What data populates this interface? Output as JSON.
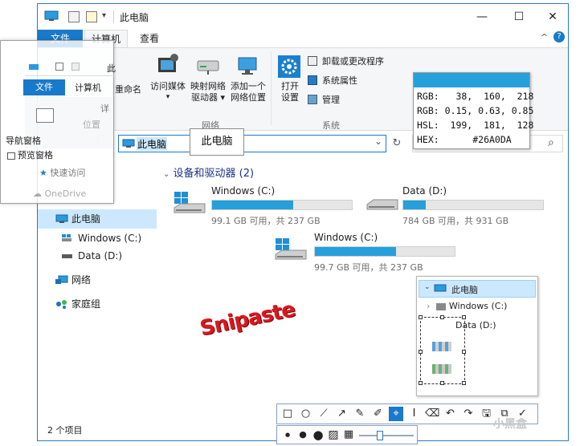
{
  "window": {
    "title": "此电脑",
    "tabs": [
      "文件",
      "计算机",
      "查看"
    ],
    "controls": {
      "minimize": "—",
      "maximize": "☐",
      "close": "✕"
    }
  },
  "ribbon": {
    "network_items": [
      {
        "label1": "访问媒体",
        "label2": "▾"
      },
      {
        "label1": "映射网络",
        "label2": "驱动器 ▾"
      },
      {
        "label1": "添加一个",
        "label2": "网络位置"
      }
    ],
    "network_group": "网络",
    "settings": {
      "label1": "打开",
      "label2": "设置"
    },
    "system_items": [
      "卸载或更改程序",
      "系统属性",
      "管理"
    ],
    "system_group": "系统",
    "partial_label": "重命名"
  },
  "address": {
    "value": "此电脑",
    "refresh": "↻",
    "dropdown": "⌄",
    "search_icon": "⌕"
  },
  "tooltip": "此电脑",
  "color_picker": {
    "swatch": "#26A0DA",
    "rows": [
      "RGB:   38,  160,  218",
      "RGB: 0.15, 0.63, 0.85",
      "HSL:  199,  181,  128",
      "HEX:      #26A0DA"
    ]
  },
  "nav": {
    "items": [
      {
        "label": "此电脑",
        "selected": true
      },
      {
        "label": "Windows (C:)"
      },
      {
        "label": "Data (D:)"
      },
      {
        "label": "网络"
      },
      {
        "label": "家庭组"
      }
    ]
  },
  "ghost_window": {
    "tabs": [
      "文件",
      "计算机"
    ],
    "items": [
      "导航窗格",
      "预览窗格",
      "快速访问",
      "OneDrive",
      "此",
      "详",
      "位置"
    ]
  },
  "content": {
    "section_title": "设备和驱动器 (2)",
    "drives": [
      {
        "name": "Windows (C:)",
        "space": "99.1 GB 可用，共 237 GB",
        "used_fraction": 0.58
      },
      {
        "name": "Data (D:)",
        "space": "784 GB 可用，共 931 GB",
        "used_fraction": 0.16
      },
      {
        "name": "Windows (C:)",
        "space": "99.7 GB 可用，共 237 GB",
        "used_fraction": 0.58
      }
    ]
  },
  "mini_tree": {
    "items": [
      "此电脑",
      "Windows (C:)",
      "Data (D:)"
    ]
  },
  "status": {
    "count": "2 个项目"
  },
  "snipaste": {
    "logo": "Snipaste",
    "watermark": "小黑盒",
    "toolbar1": [
      "□",
      "○",
      "⟋",
      "↗",
      "✎",
      "✐",
      "⌖",
      "I",
      "⌫",
      "↶",
      "↷",
      "🖫",
      "⧉",
      "✓"
    ],
    "toolbar2": [
      "●",
      "●",
      "●",
      "▨",
      "▦"
    ]
  },
  "colors": {
    "accent": "#26A0DA",
    "file_tab": "#1979CA",
    "logo": "#D9181F"
  }
}
